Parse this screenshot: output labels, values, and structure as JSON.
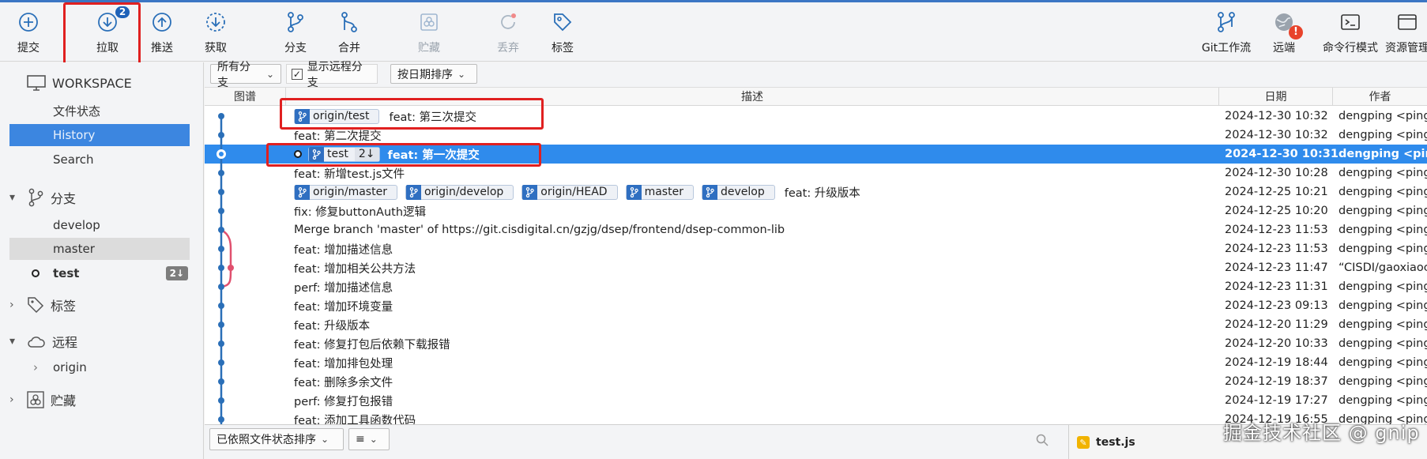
{
  "toolbar": {
    "commit": "提交",
    "pull": "拉取",
    "pull_badge": "2",
    "push": "推送",
    "fetch": "获取",
    "branch": "分支",
    "merge": "合并",
    "stash": "贮藏",
    "discard": "丢弃",
    "tag": "标签",
    "gitflow": "Git工作流",
    "remote": "远端",
    "remote_badge": "!",
    "terminal": "命令行模式",
    "explorer": "资源管理"
  },
  "sidebar": {
    "workspace": "WORKSPACE",
    "workspace_items": [
      "文件状态",
      "History",
      "Search"
    ],
    "branches_title": "分支",
    "branches": [
      "develop",
      "master",
      "test"
    ],
    "test_count": "2↓",
    "tags_title": "标签",
    "remotes_title": "远程",
    "remotes": [
      "origin"
    ],
    "stash_title": "贮藏"
  },
  "filter": {
    "branch_filter": "所有分支",
    "show_remote": "显示远程分支",
    "show_remote_check": "✓",
    "sort": "按日期排序"
  },
  "columns": {
    "graph": "图谱",
    "desc": "描述",
    "date": "日期",
    "author": "作者"
  },
  "commits": [
    {
      "tags": [
        "origin/test"
      ],
      "msg": "feat: 第三次提交",
      "date": "2024-12-30 10:32",
      "author": "dengping <ping"
    },
    {
      "tags": [],
      "msg": "feat: 第二次提交",
      "date": "2024-12-30 10:32",
      "author": "dengping <ping"
    },
    {
      "tags": [
        "test"
      ],
      "tag_count": "2↓",
      "msg": "feat: 第一次提交",
      "date": "2024-12-30 10:31",
      "author": "dengping <pin"
    },
    {
      "tags": [],
      "msg": "feat: 新增test.js文件",
      "date": "2024-12-30 10:28",
      "author": "dengping <ping"
    },
    {
      "tags": [
        "origin/master",
        "origin/develop",
        "origin/HEAD",
        "master",
        "develop"
      ],
      "msg": "feat: 升级版本",
      "date": "2024-12-25 10:21",
      "author": "dengping <ping"
    },
    {
      "tags": [],
      "msg": "fix: 修复buttonAuth逻辑",
      "date": "2024-12-25 10:20",
      "author": "dengping <ping"
    },
    {
      "tags": [],
      "msg": "Merge branch 'master' of https://git.cisdigital.cn/gzjg/dsep/frontend/dsep-common-lib",
      "date": "2024-12-23 11:53",
      "author": "dengping <ping"
    },
    {
      "tags": [],
      "msg": "feat: 增加描述信息",
      "date": "2024-12-23 11:53",
      "author": "dengping <ping"
    },
    {
      "tags": [],
      "msg": "feat: 增加相关公共方法",
      "date": "2024-12-23 11:47",
      "author": "“CISDI/gaoxiaoc"
    },
    {
      "tags": [],
      "msg": "perf: 增加描述信息",
      "date": "2024-12-23 11:31",
      "author": "dengping <ping"
    },
    {
      "tags": [],
      "msg": "feat: 增加环境变量",
      "date": "2024-12-23 09:13",
      "author": "dengping <ping"
    },
    {
      "tags": [],
      "msg": "feat: 升级版本",
      "date": "2024-12-20 11:29",
      "author": "dengping <ping"
    },
    {
      "tags": [],
      "msg": "feat: 修复打包后依赖下载报错",
      "date": "2024-12-20 10:33",
      "author": "dengping <ping"
    },
    {
      "tags": [],
      "msg": "feat: 增加排包处理",
      "date": "2024-12-19 18:44",
      "author": "dengping <ping"
    },
    {
      "tags": [],
      "msg": "feat: 删除多余文件",
      "date": "2024-12-19 18:37",
      "author": "dengping <ping"
    },
    {
      "tags": [],
      "msg": "perf: 修复打包报错",
      "date": "2024-12-19 17:27",
      "author": "dengping <ping"
    },
    {
      "tags": [],
      "msg": "feat: 添加工具函数代码",
      "date": "2024-12-19 16:55",
      "author": "dengping <ping"
    }
  ],
  "bottom": {
    "sort_by_status": "已依照文件状态排序",
    "list_icon": "≡",
    "file": "test.js"
  },
  "watermark": "掘金技术社区 @ gnip",
  "colors": {
    "selection": "#2f8bec",
    "sidebar_active": "#3c86e0",
    "graph_line": "#2a6fb8",
    "merge_line": "#e0506e",
    "highlight_red": "#e02020"
  }
}
